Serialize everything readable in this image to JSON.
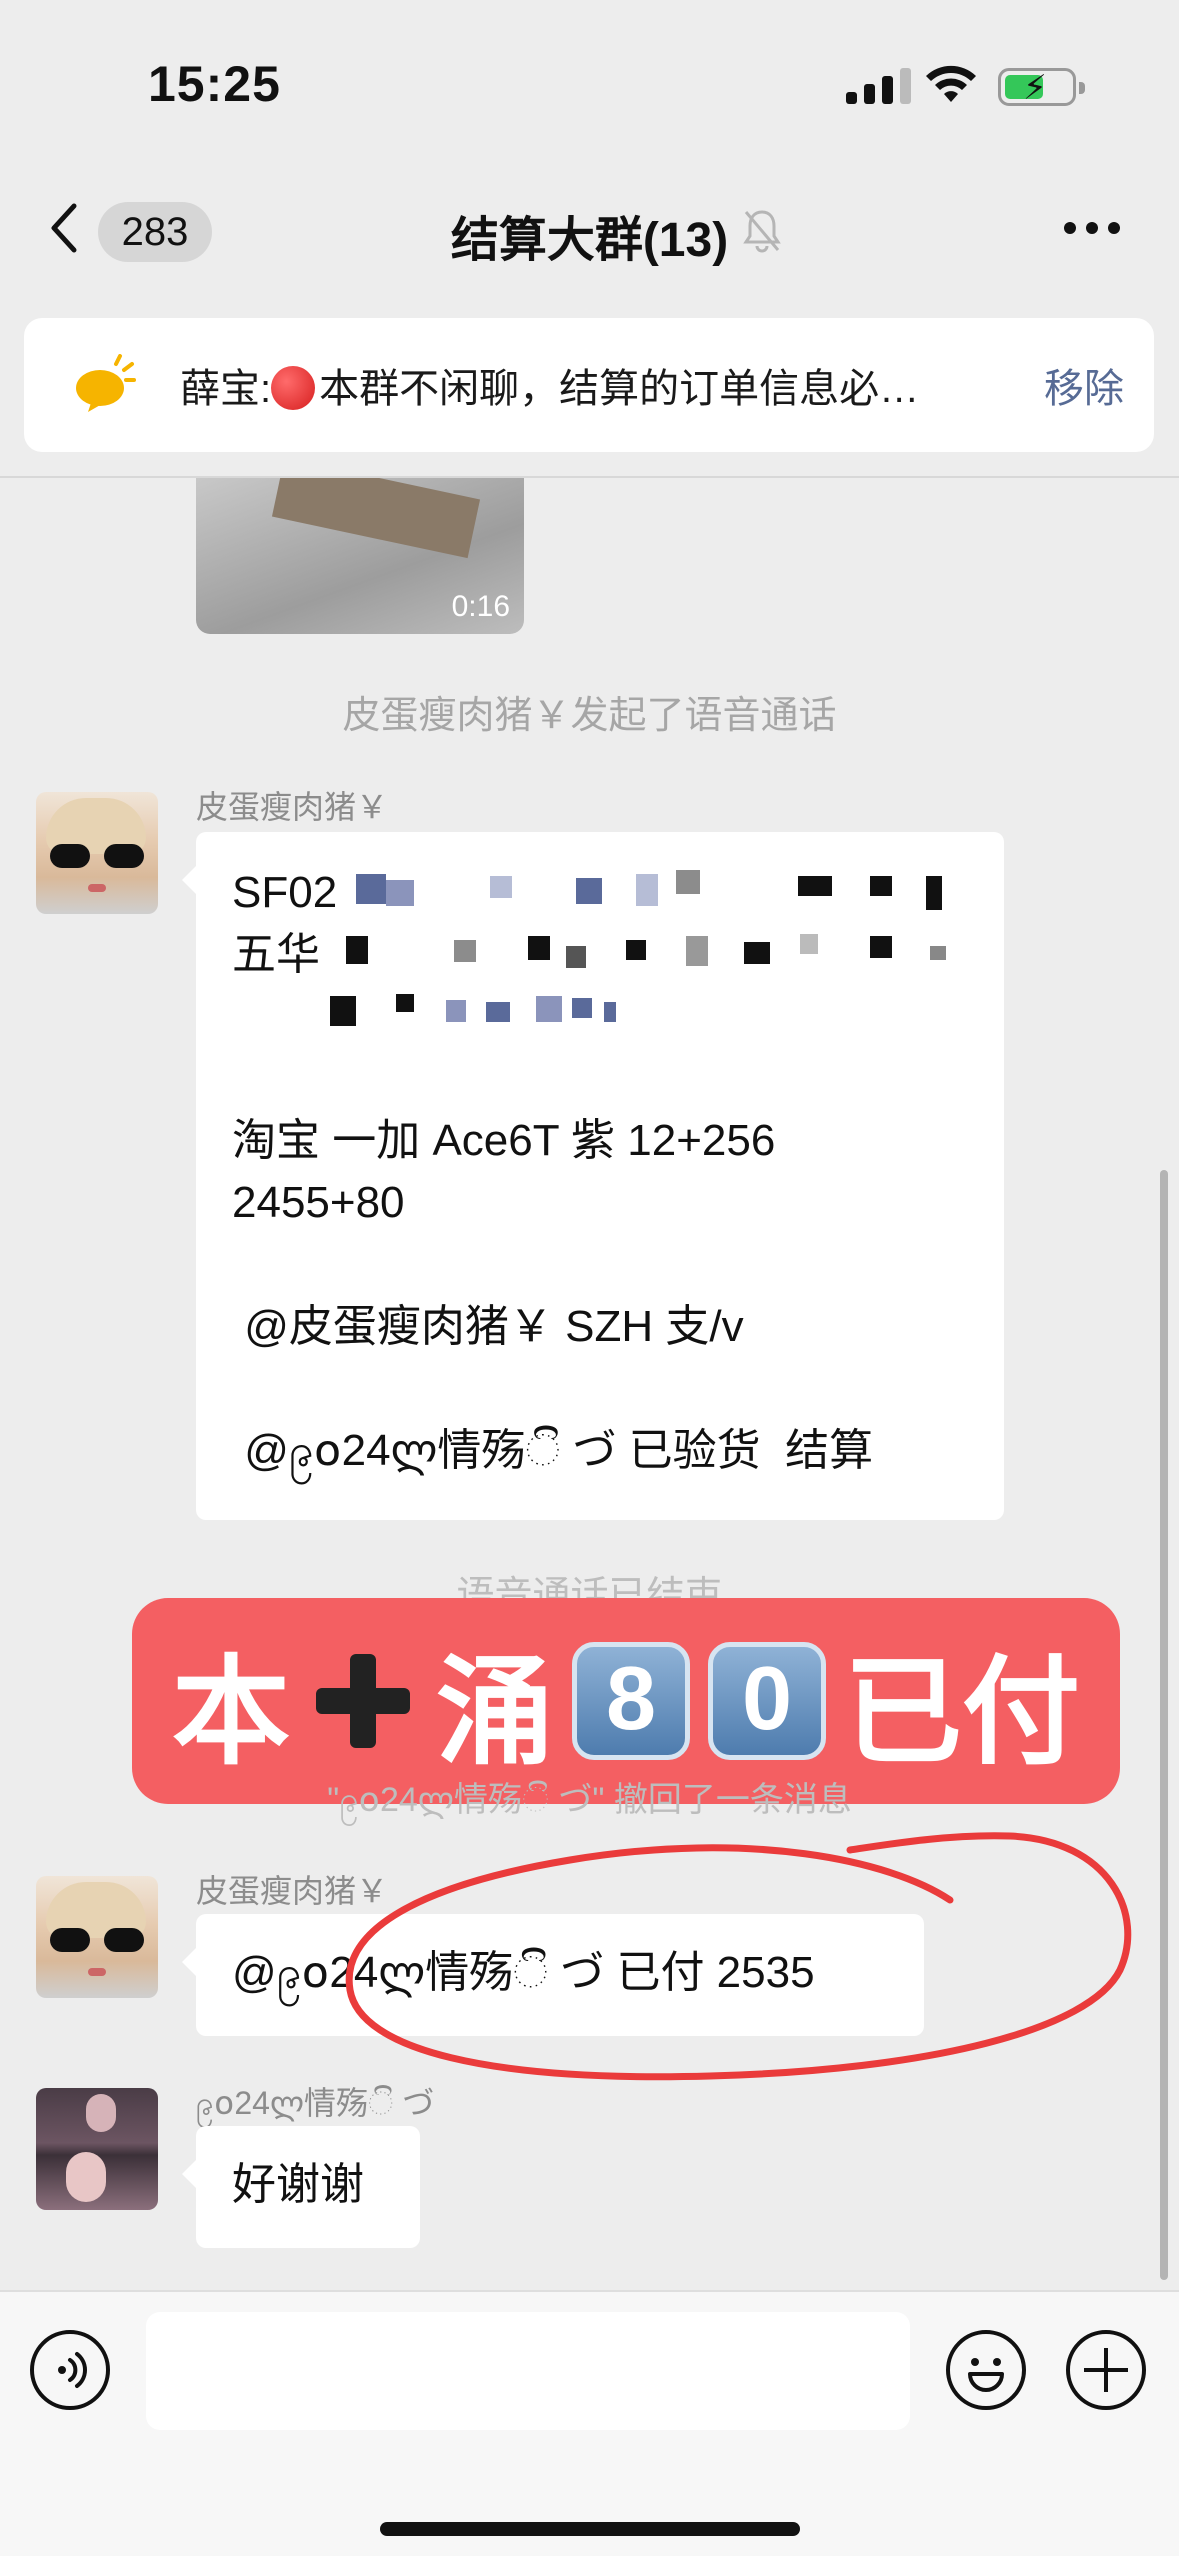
{
  "status_bar": {
    "time": "15:25"
  },
  "nav": {
    "unread_count": "283",
    "title": "结算大群(13)"
  },
  "pinned": {
    "sender": "薛宝:",
    "text": "本群不闲聊，结算的订单信息必…",
    "remove_label": "移除"
  },
  "chat": {
    "video_duration": "0:16",
    "sys_call_started": "皮蛋瘦肉猪￥发起了语音通话",
    "msg1": {
      "sender": "皮蛋瘦肉猪￥",
      "line1_prefix": "SF02",
      "line2_prefix": "五华",
      "line4": "淘宝 一加 Ace6T 紫 12+256",
      "line5": "2455+80",
      "line7": " @皮蛋瘦肉猪￥ SZH 支/v",
      "line9": " @၉໐24ლ情殇ි づ 已验货  结算"
    },
    "sys_call_ended": "语音通话已结束",
    "sys_recalled": "\"၉໐24ლ情殇ි づ\" 撤回了一条消息",
    "banner": {
      "text_a": "本",
      "text_b": "涌",
      "key1": "8",
      "key2": "0",
      "text_c": "已付"
    },
    "msg2": {
      "sender": "皮蛋瘦肉猪￥",
      "text": "@၉໐24ლ情殇ි づ 已付 2535"
    },
    "msg3": {
      "sender": "၉໐24ლ情殇ි づ",
      "text": "好谢谢"
    }
  },
  "input": {
    "placeholder": ""
  }
}
